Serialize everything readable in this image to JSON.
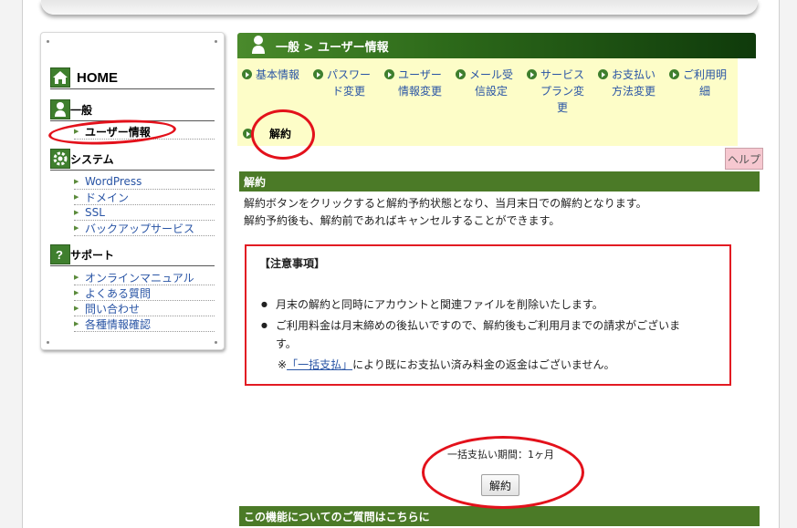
{
  "sidebar": {
    "home_label": "HOME",
    "general": {
      "label": "一般",
      "items": [
        {
          "label": "ユーザー情報"
        }
      ]
    },
    "system": {
      "label": "システム",
      "items": [
        {
          "label": "WordPress"
        },
        {
          "label": "ドメイン"
        },
        {
          "label": "SSL"
        },
        {
          "label": "バックアップサービス"
        }
      ]
    },
    "support": {
      "label": "サポート",
      "items": [
        {
          "label": "オンラインマニュアル"
        },
        {
          "label": "よくある質問"
        },
        {
          "label": "問い合わせ"
        },
        {
          "label": "各種情報確認"
        }
      ]
    }
  },
  "header": {
    "breadcrumb": "一般 > ユーザー情報"
  },
  "menu": {
    "items": [
      {
        "label": "基本情報"
      },
      {
        "label_1": "パスワー",
        "label_2": "ド変更"
      },
      {
        "label_1": "ユーザー",
        "label_2": "情報変更"
      },
      {
        "label_1": "メール受",
        "label_2": "信設定"
      },
      {
        "label_1": "サービス",
        "label_2": "プラン変",
        "label_3": "更"
      },
      {
        "label_1": "お支払い",
        "label_2": "方法変更"
      },
      {
        "label_1": "ご利用明",
        "label_2": "細"
      }
    ],
    "active_label": "解約"
  },
  "help_label": "ヘルプ",
  "section": {
    "title": "解約",
    "desc_1": "解約ボタンをクリックすると解約予約状態となり、当月末日での解約となります。",
    "desc_2": "解約予約後も、解約前であればキャンセルすることができます。"
  },
  "notice": {
    "title": "【注意事項】",
    "bullet_1": "月末の解約と同時にアカウントと関連ファイルを削除いたします。",
    "bullet_2a": "ご利用料金は月末締めの後払いですので、解約後もご利用月までの請求がございま",
    "bullet_2b": "す。",
    "note_prefix": "※",
    "note_link": "「一括支払」",
    "note_suffix": "により既にお支払い済み料金の返金はございません。"
  },
  "payment": {
    "period": "一括支払い期間：1ヶ月"
  },
  "cancel_button": "解約",
  "faq_title": "この機能についてのご質問はこちらに",
  "colors": {
    "accent_green": "#4b7a27",
    "annotation_red": "#e3111b",
    "menu_bg": "#fdfdc8",
    "link": "#2a55a5"
  }
}
